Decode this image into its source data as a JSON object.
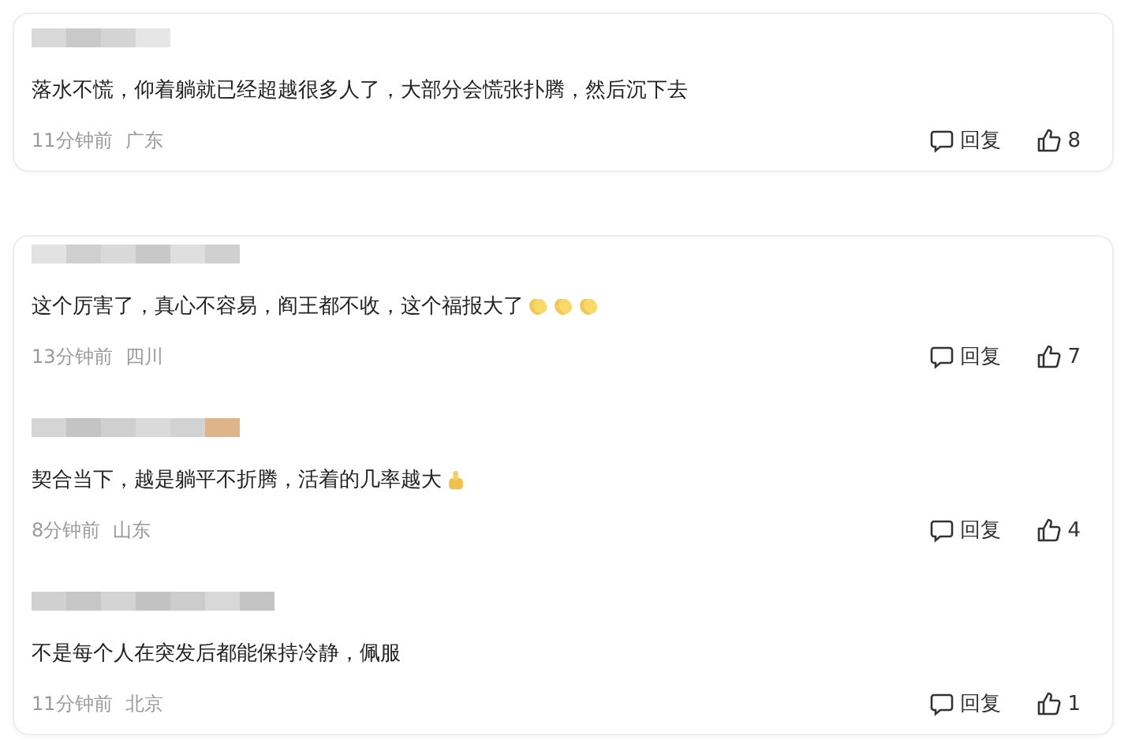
{
  "cards": [
    {
      "comments": [
        {
          "text": "落水不慌，仰着躺就已经超越很多人了，大部分会慌张扑腾，然后沉下去",
          "time": "11分钟前",
          "location": "广东",
          "reply": "回复",
          "likes": "8"
        }
      ]
    },
    {
      "comments": [
        {
          "text": "这个厉害了，真心不容易，阎王都不收，这个福报大了",
          "emojis": [
            {
              "kind": "clap"
            },
            {
              "kind": "clap"
            },
            {
              "kind": "clap"
            }
          ],
          "time": "13分钟前",
          "location": "四川",
          "reply": "回复",
          "likes": "7"
        },
        {
          "text": "契合当下，越是躺平不折腾，活着的几率越大",
          "emojis": [
            {
              "kind": "thumb"
            }
          ],
          "time": "8分钟前",
          "location": "山东",
          "reply": "回复",
          "likes": "4"
        },
        {
          "text": "不是每个人在突发后都能保持冷静，佩服",
          "time": "11分钟前",
          "location": "北京",
          "reply": "回复",
          "likes": "1"
        }
      ]
    }
  ]
}
